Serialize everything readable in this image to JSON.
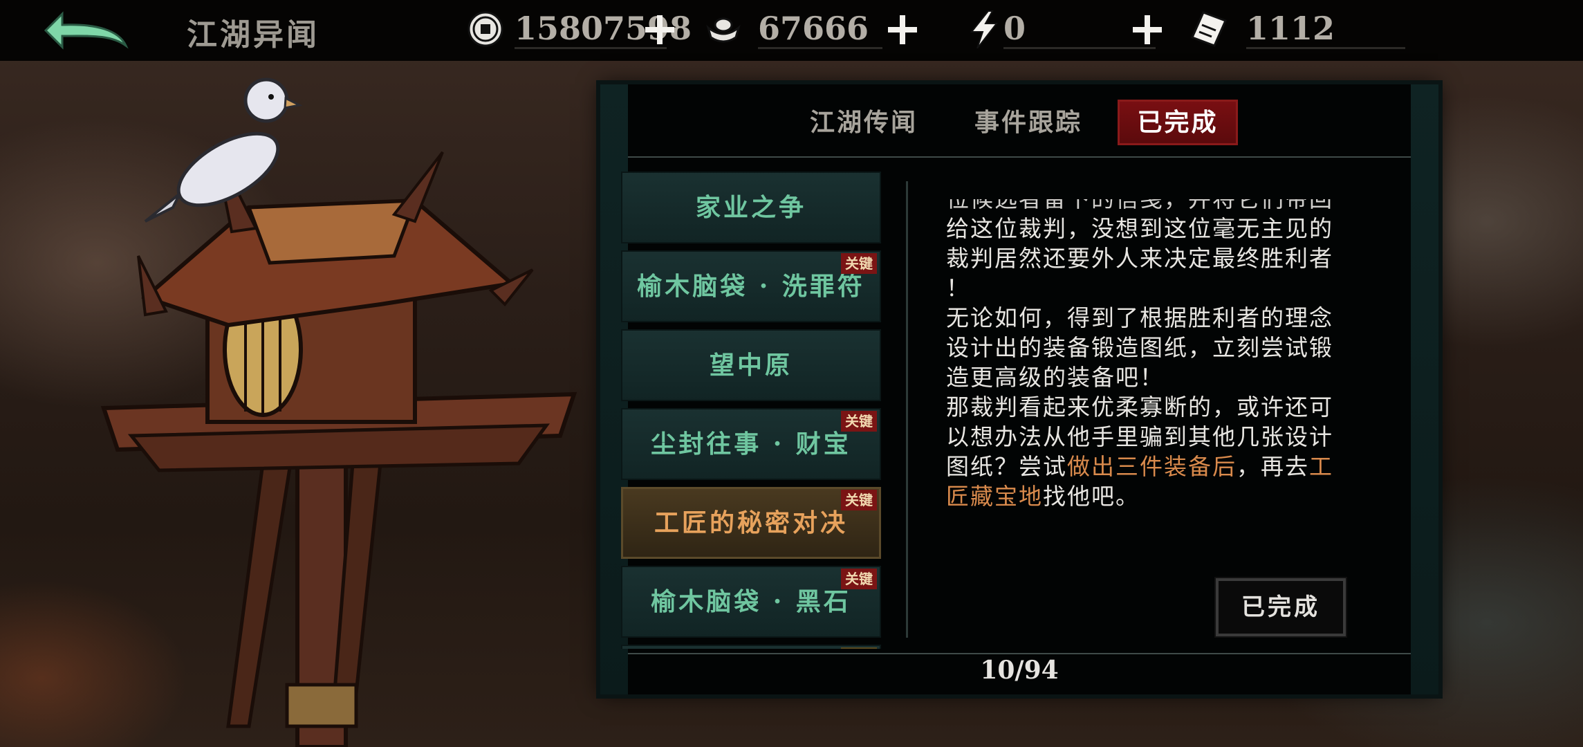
{
  "header": {
    "title": "江湖异闻",
    "currencies": [
      {
        "icon": "coin-icon",
        "value": "15807598"
      },
      {
        "icon": "silver-ingot-icon",
        "value": "67666"
      },
      {
        "icon": "lightning-icon",
        "value": "0"
      },
      {
        "icon": "ticket-icon",
        "value": "1112"
      }
    ]
  },
  "tabs": [
    {
      "label": "江湖传闻"
    },
    {
      "label": "事件跟踪"
    },
    {
      "label": "已完成"
    }
  ],
  "events": [
    {
      "label": "家业之争",
      "badge": ""
    },
    {
      "label": "榆木脑袋 · 洗罪符",
      "badge": "关键"
    },
    {
      "label": "望中原",
      "badge": ""
    },
    {
      "label": "尘封往事 · 财宝",
      "badge": "关键"
    },
    {
      "label": "工匠的秘密对决",
      "badge": "关键"
    },
    {
      "label": "榆木脑袋 · 黑石",
      "badge": "关键"
    },
    {
      "label": "",
      "badge": "关键"
    }
  ],
  "detail": {
    "partial_line": "位候选者留下的信笺，并将它们带回",
    "line1": "给这位裁判，没想到这位毫无主见的",
    "line2": "裁判居然还要外人来决定最终胜利者",
    "line3": "！",
    "line4": "无论如何，得到了根据胜利者的理念",
    "line5": "设计出的装备锻造图纸，立刻尝试锻",
    "line6": "造更高级的装备吧！",
    "line7": "那裁判看起来优柔寡断的，或许还可",
    "line8": "以想办法从他手里骗到其他几张设计",
    "line9_a": "图纸？尝试",
    "line9_hl": "做出三件装备后",
    "line9_b": "，再去",
    "line9_hl2": "工",
    "line10_hl": "匠藏宝地",
    "line10_b": "找他吧。"
  },
  "done_button": "已完成",
  "pagination": "10/94",
  "colors": {
    "tab_active": "#6e0e10",
    "list_text": "#6fc6a0",
    "list_active_text": "#e7a25c",
    "highlight_text": "#d98a4c"
  }
}
